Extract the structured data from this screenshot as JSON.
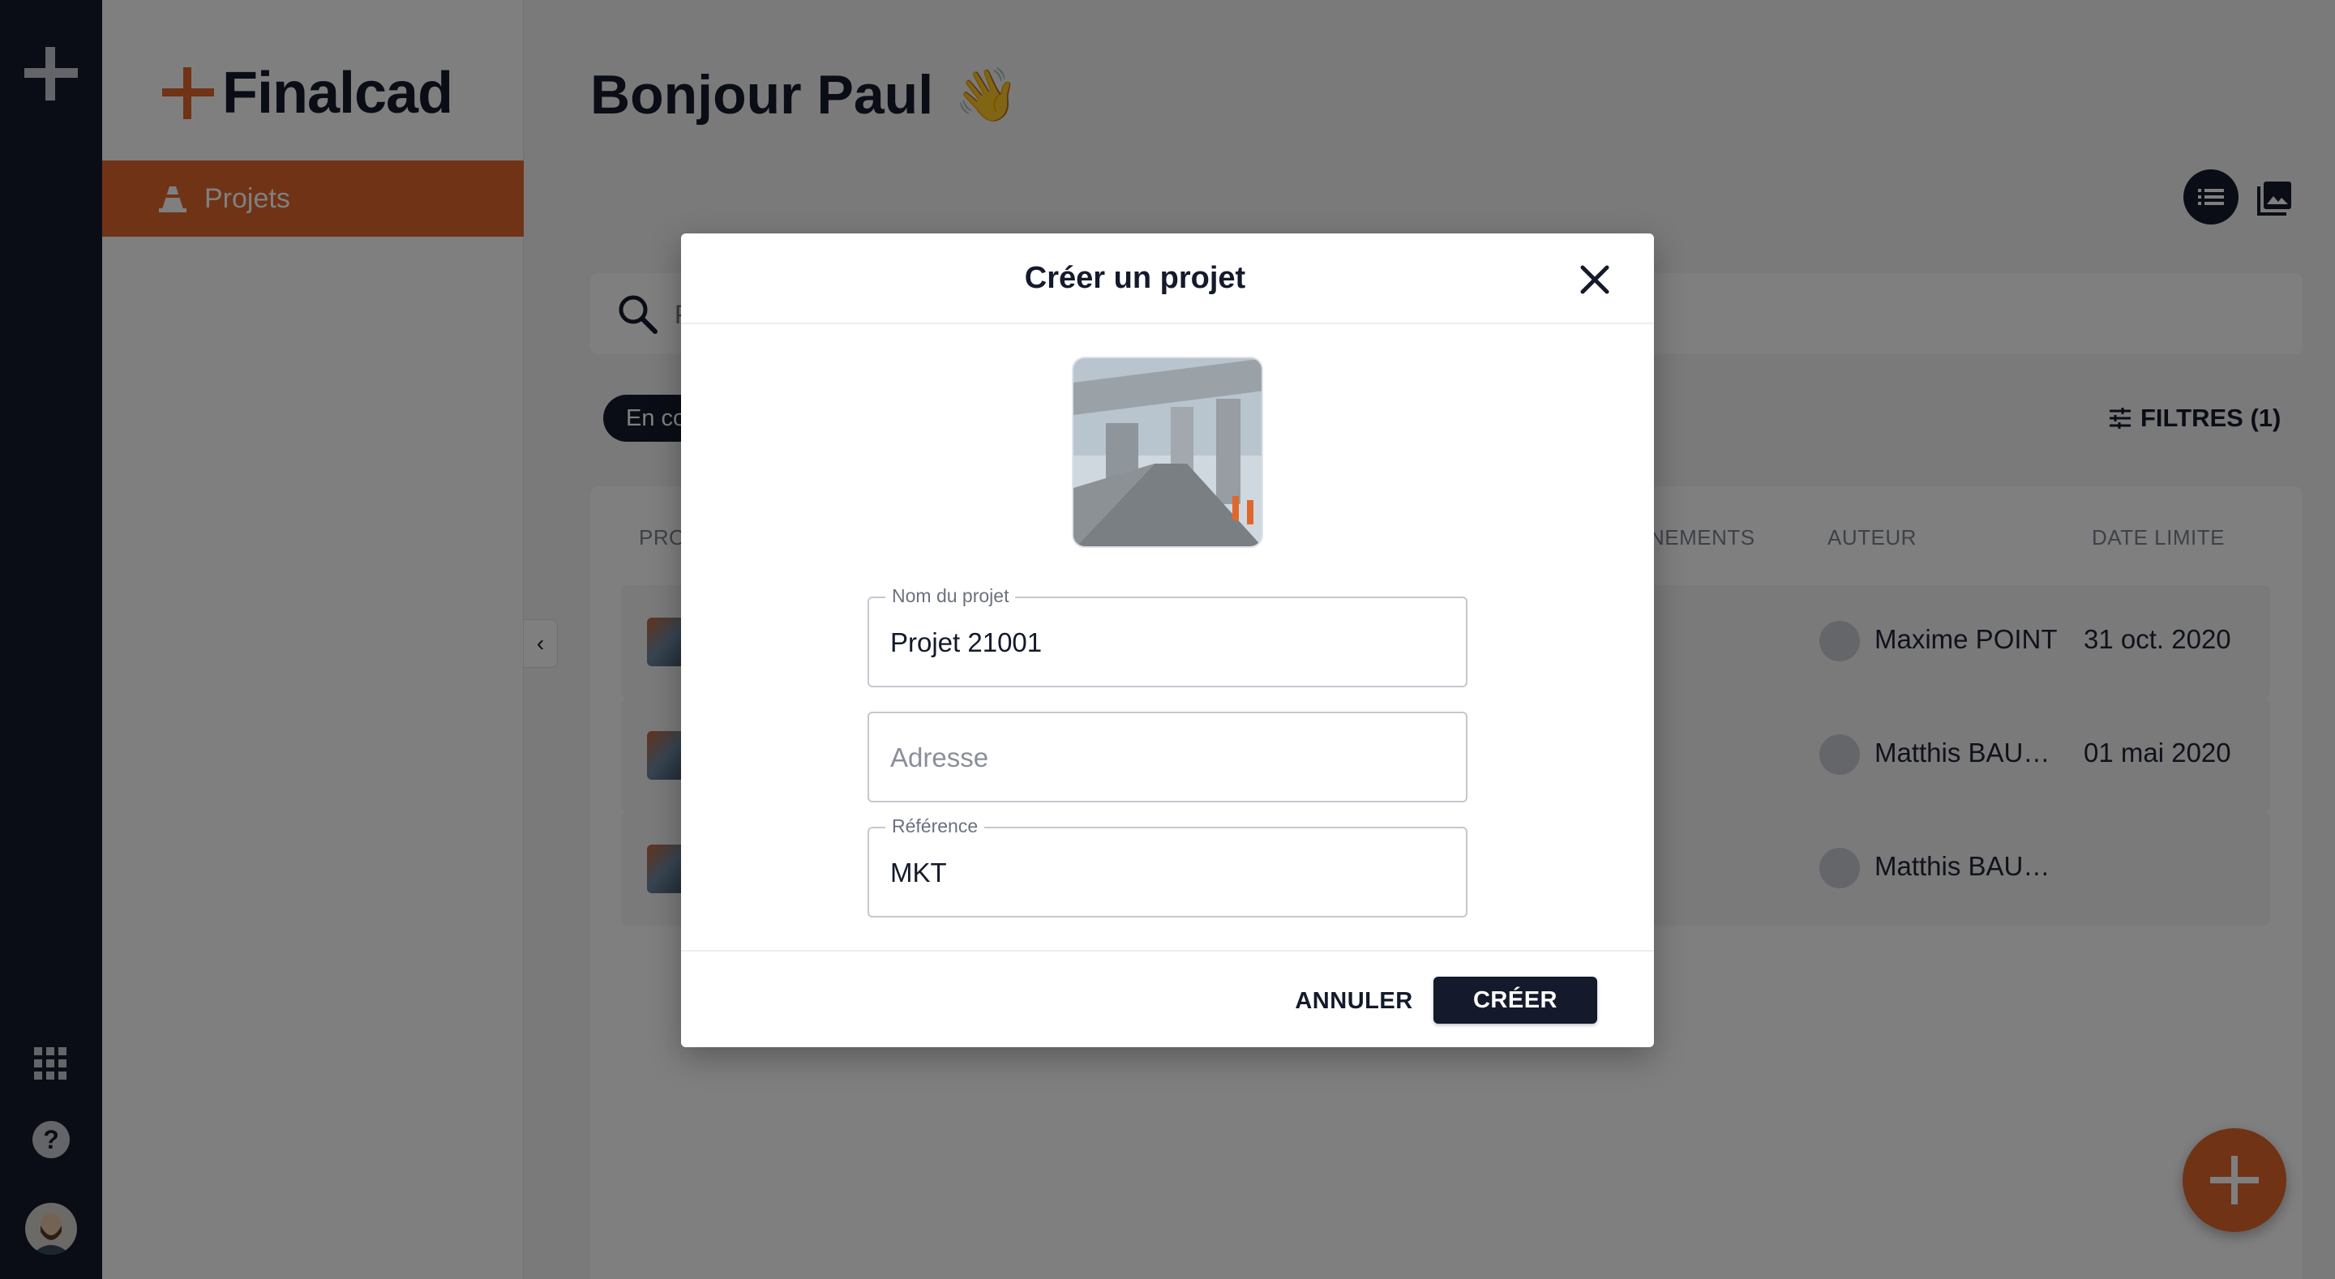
{
  "app": {
    "brand": "Finalcad"
  },
  "sidebar": {
    "nav_projects": "Projets"
  },
  "header": {
    "greeting": "Bonjour Paul",
    "wave_emoji": "👋"
  },
  "search": {
    "placeholder": "P"
  },
  "status_chip": "En co",
  "filters_label": "FILTRES (1)",
  "table": {
    "columns": [
      "PRO",
      "NEMENTS",
      "AUTEUR",
      "DATE LIMITE"
    ],
    "rows": [
      {
        "author": "Maxime POINT",
        "date": "31 oct. 2020"
      },
      {
        "author": "Matthis BAUD…",
        "date": "01 mai 2020"
      },
      {
        "author": "Matthis BAUD…",
        "date": ""
      }
    ]
  },
  "modal": {
    "title": "Créer un projet",
    "fields": {
      "name": {
        "label": "Nom du projet",
        "value": "Projet 21001"
      },
      "address": {
        "placeholder": "Adresse",
        "value": ""
      },
      "reference": {
        "label": "Référence",
        "value": "MKT"
      }
    },
    "cancel_label": "ANNULER",
    "create_label": "CRÉER"
  },
  "icons": {
    "rail": [
      "plus-logo-icon",
      "apps-grid-icon",
      "help-icon",
      "user-avatar"
    ],
    "view": [
      "list-view-icon",
      "gallery-view-icon"
    ],
    "modal": [
      "close-icon"
    ],
    "table": [
      "no-image-icon"
    ]
  },
  "colors": {
    "accent": "#e0672c",
    "dark": "#141a2b"
  }
}
